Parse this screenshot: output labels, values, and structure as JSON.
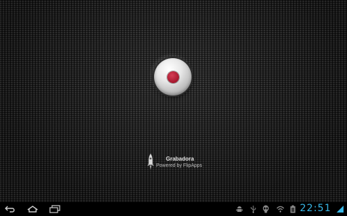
{
  "app": {
    "name": "Grabadora",
    "powered_by": "Powered by FlipApps"
  },
  "record_button": {
    "icon": "record-icon",
    "accent_color": "#a5162c"
  },
  "nav": {
    "back_icon": "back-icon",
    "home_icon": "home-icon",
    "recents_icon": "recent-apps-icon"
  },
  "status_bar": {
    "icons": [
      "android-debug-icon",
      "usb-icon",
      "alien-icon",
      "wifi-icon",
      "battery-icon"
    ],
    "time": "22:51",
    "clock_color": "#39b8e8"
  }
}
